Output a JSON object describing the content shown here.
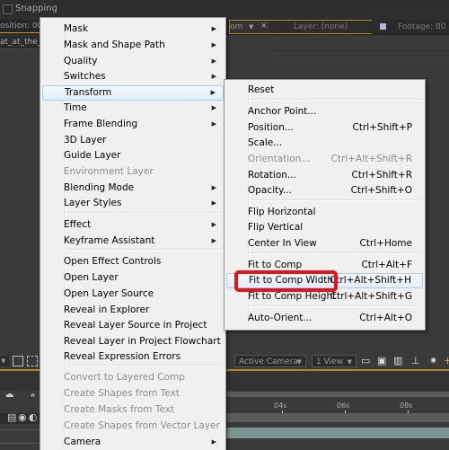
{
  "app": {
    "snapping_label": "Snapping",
    "snapping_checked": false,
    "left_tab_label": "osition: 00",
    "left_layer_name": "at_at_the_",
    "comp_tab_label": "om",
    "layer_tab_label": "Layer: (none)",
    "footage_tab_label": "Footage: 80",
    "footage_swatch_color": "#b5b5d8",
    "accent_color": "#b08a2a"
  },
  "viewer_toolbar": {
    "camera_select": "Active Camera",
    "view_select": "1 View"
  },
  "timeline": {
    "ticks": [
      "04s",
      "06s",
      "08s"
    ],
    "track_color": "#7c9590"
  },
  "context_menu": {
    "items": [
      {
        "label": "Mask",
        "submenu": true,
        "disabled": false
      },
      {
        "label": "Mask and Shape Path",
        "submenu": true,
        "disabled": false
      },
      {
        "label": "Quality",
        "submenu": true,
        "disabled": false
      },
      {
        "label": "Switches",
        "submenu": true,
        "disabled": false
      },
      {
        "label": "Transform",
        "submenu": true,
        "disabled": false,
        "highlighted": true
      },
      {
        "label": "Time",
        "submenu": true,
        "disabled": false
      },
      {
        "label": "Frame Blending",
        "submenu": true,
        "disabled": false
      },
      {
        "label": "3D Layer",
        "submenu": false,
        "disabled": false
      },
      {
        "label": "Guide Layer",
        "submenu": false,
        "disabled": false
      },
      {
        "label": "Environment Layer",
        "submenu": false,
        "disabled": true
      },
      {
        "label": "Blending Mode",
        "submenu": true,
        "disabled": false
      },
      {
        "label": "Layer Styles",
        "submenu": true,
        "disabled": false
      },
      {
        "label": "Effect",
        "submenu": true,
        "disabled": false
      },
      {
        "label": "Keyframe Assistant",
        "submenu": true,
        "disabled": false
      },
      {
        "label": "Open Effect Controls",
        "submenu": false,
        "disabled": false
      },
      {
        "label": "Open Layer",
        "submenu": false,
        "disabled": false
      },
      {
        "label": "Open Layer Source",
        "submenu": false,
        "disabled": false
      },
      {
        "label": "Reveal in Explorer",
        "submenu": false,
        "disabled": false
      },
      {
        "label": "Reveal Layer Source in Project",
        "submenu": false,
        "disabled": false
      },
      {
        "label": "Reveal Layer in Project Flowchart",
        "submenu": false,
        "disabled": false
      },
      {
        "label": "Reveal Expression Errors",
        "submenu": false,
        "disabled": false
      },
      {
        "label": "Convert to Layered Comp",
        "submenu": false,
        "disabled": true
      },
      {
        "label": "Create Shapes from Text",
        "submenu": false,
        "disabled": true
      },
      {
        "label": "Create Masks from Text",
        "submenu": false,
        "disabled": true
      },
      {
        "label": "Create Shapes from Vector Layer",
        "submenu": false,
        "disabled": true
      },
      {
        "label": "Camera",
        "submenu": true,
        "disabled": false
      }
    ],
    "submenu_arrow": "▶"
  },
  "transform_submenu": {
    "items": [
      {
        "label": "Reset",
        "shortcut": "",
        "disabled": false
      },
      {
        "label": "Anchor Point...",
        "shortcut": "",
        "disabled": false
      },
      {
        "label": "Position...",
        "shortcut": "Ctrl+Shift+P",
        "disabled": false
      },
      {
        "label": "Scale...",
        "shortcut": "",
        "disabled": false
      },
      {
        "label": "Orientation...",
        "shortcut": "Ctrl+Alt+Shift+R",
        "disabled": true
      },
      {
        "label": "Rotation...",
        "shortcut": "Ctrl+Shift+R",
        "disabled": false
      },
      {
        "label": "Opacity...",
        "shortcut": "Ctrl+Shift+O",
        "disabled": false
      },
      {
        "label": "Flip Horizontal",
        "shortcut": "",
        "disabled": false
      },
      {
        "label": "Flip Vertical",
        "shortcut": "",
        "disabled": false
      },
      {
        "label": "Center In View",
        "shortcut": "Ctrl+Home",
        "disabled": false
      },
      {
        "label": "Fit to Comp",
        "shortcut": "Ctrl+Alt+F",
        "disabled": false
      },
      {
        "label": "Fit to Comp Width",
        "shortcut": "Ctrl+Alt+Shift+H",
        "disabled": false,
        "highlighted": true
      },
      {
        "label": "Fit to Comp Height",
        "shortcut": "Ctrl+Alt+Shift+G",
        "disabled": false
      },
      {
        "label": "Auto-Orient...",
        "shortcut": "Ctrl+Alt+O",
        "disabled": false
      }
    ],
    "annotation_color": "#e5141b"
  }
}
